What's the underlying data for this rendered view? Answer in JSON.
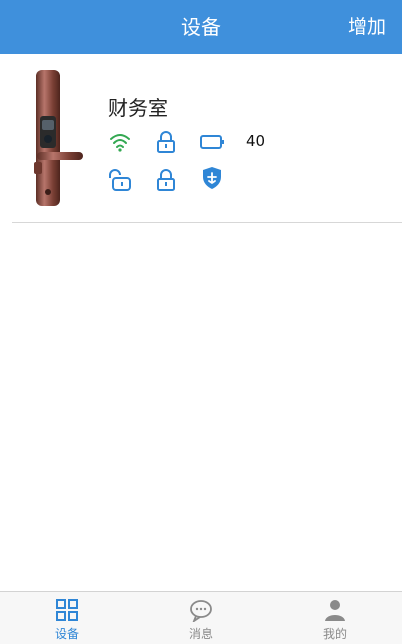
{
  "header": {
    "title": "设备",
    "add_label": "增加"
  },
  "device": {
    "name": "财务室",
    "battery_level": "40",
    "status_icons": [
      "wifi-icon",
      "lock-icon",
      "battery-icon",
      "unlock-icon",
      "lock-icon",
      "authorize-shield-icon"
    ]
  },
  "nav": {
    "items": [
      {
        "label": "设备",
        "icon": "grid-icon",
        "active": true
      },
      {
        "label": "消息",
        "icon": "chat-icon",
        "active": false
      },
      {
        "label": "我的",
        "icon": "person-icon",
        "active": false
      }
    ]
  },
  "colors": {
    "header": "#3f90dc",
    "accent": "#2f86d6",
    "wifi": "#33a852",
    "inactive": "#8a8a8a"
  }
}
